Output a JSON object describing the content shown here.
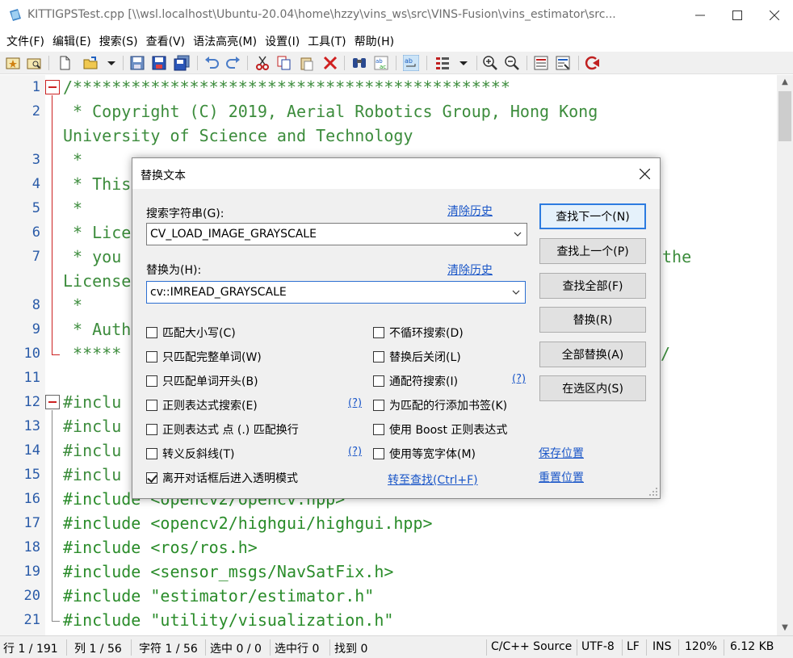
{
  "window": {
    "title": "KITTIGPSTest.cpp [\\\\wsl.localhost\\Ubuntu-20.04\\home\\hzzy\\vins_ws\\src\\VINS-Fusion\\vins_estimator\\src...",
    "minimize_label": "—",
    "maximize_label": "☐",
    "close_label": "✕"
  },
  "menu": [
    "文件(F)",
    "编辑(E)",
    "搜索(S)",
    "查看(V)",
    "语法高亮(M)",
    "设置(I)",
    "工具(T)",
    "帮助(H)"
  ],
  "editor": {
    "lines": [
      {
        "n": "1",
        "text": "/*********************************************"
      },
      {
        "n": "2",
        "text": " * Copyright (C) 2019, Aerial Robotics Group, Hong Kong"
      },
      {
        "n": "",
        "text": "University of Science and Technology"
      },
      {
        "n": "3",
        "text": " *"
      },
      {
        "n": "4",
        "text": " * This"
      },
      {
        "n": "5",
        "text": " *"
      },
      {
        "n": "6",
        "text": " * Lice"
      },
      {
        "n": "7",
        "text": " * you",
        "tail": "the"
      },
      {
        "n": "",
        "text": "License"
      },
      {
        "n": "8",
        "text": " *"
      },
      {
        "n": "9",
        "text": " * Auth"
      },
      {
        "n": "10",
        "text": " *****",
        "tail": "/"
      },
      {
        "n": "11",
        "text": ""
      },
      {
        "n": "12",
        "text": "#inclu"
      },
      {
        "n": "13",
        "text": "#inclu"
      },
      {
        "n": "14",
        "text": "#inclu"
      },
      {
        "n": "15",
        "text": "#inclu"
      },
      {
        "n": "16",
        "kw": "#include",
        "str": " <opencv2/opencv.hpp>"
      },
      {
        "n": "17",
        "kw": "#include",
        "str": " <opencv2/highgui/highgui.hpp>"
      },
      {
        "n": "18",
        "kw": "#include",
        "str": " <ros/ros.h>"
      },
      {
        "n": "19",
        "kw": "#include",
        "str": " <sensor_msgs/NavSatFix.h>"
      },
      {
        "n": "20",
        "kw": "#include",
        "str": " \"estimator/estimator.h\""
      },
      {
        "n": "21",
        "kw": "#include",
        "str": " \"utility/visualization.h\""
      }
    ]
  },
  "statusbar": {
    "line": "行 1 / 191",
    "col": "列 1 / 56",
    "char": "字符 1 / 56",
    "selected": "选中 0 / 0",
    "selected_lines": "选中行 0",
    "found": "找到 0",
    "syntax": "C/C++ Source",
    "encoding": "UTF-8",
    "eol": "LF",
    "mode": "INS",
    "zoom": "120%",
    "size": "6.12 KB"
  },
  "dialog": {
    "title": "替换文本",
    "search_label": "搜索字符串(G):",
    "search_clear": "清除历史",
    "search_value": "CV_LOAD_IMAGE_GRAYSCALE",
    "replace_label": "替换为(H):",
    "replace_clear": "清除历史",
    "replace_value": "cv::IMREAD_GRAYSCALE",
    "buttons": {
      "find_next": "查找下一个(N)",
      "find_prev": "查找上一个(P)",
      "find_all": "查找全部(F)",
      "replace": "替换(R)",
      "replace_all": "全部替换(A)",
      "in_selection": "在选区内(S)"
    },
    "options_left": [
      {
        "label": "匹配大小写(C)",
        "checked": false
      },
      {
        "label": "只匹配完整单词(W)",
        "checked": false
      },
      {
        "label": "只匹配单词开头(B)",
        "checked": false
      },
      {
        "label": "正则表达式搜索(E)",
        "checked": false
      },
      {
        "label": "正则表达式 点 (.) 匹配换行",
        "checked": false
      },
      {
        "label": "转义反斜线(T)",
        "checked": false
      },
      {
        "label": "离开对话框后进入透明模式",
        "checked": true
      }
    ],
    "options_right": [
      {
        "label": "不循环搜索(D)",
        "checked": false
      },
      {
        "label": "替换后关闭(L)",
        "checked": false
      },
      {
        "label": "通配符搜索(I)",
        "checked": false
      },
      {
        "label": "为匹配的行添加书签(K)",
        "checked": false
      },
      {
        "label": "使用 Boost 正则表达式",
        "checked": false
      },
      {
        "label": "使用等宽字体(M)",
        "checked": false
      }
    ],
    "help_marks": [
      "(?)",
      "(?)",
      "(?)"
    ],
    "goto_find": "转至查找(Ctrl+F)",
    "save_position": "保存位置",
    "reset_position": "重置位置"
  },
  "colors": {
    "accent": "#2c7be0",
    "link": "#1a56c8",
    "code_green": "#2a8c2a",
    "line_number": "#2a5ba8",
    "fold_red": "#cc2222"
  }
}
